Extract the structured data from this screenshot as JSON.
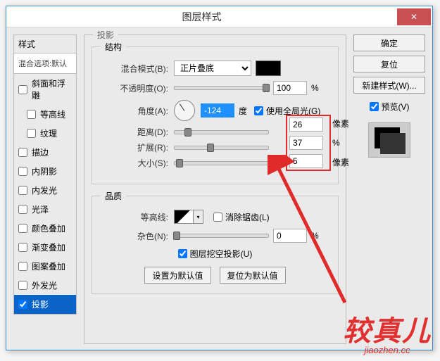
{
  "titlebar": {
    "title": "图层样式",
    "close": "✕"
  },
  "styles": {
    "header": "样式",
    "blend_options": "混合选项:默认",
    "items": [
      {
        "label": "斜面和浮雕",
        "checked": false
      },
      {
        "label": "等高线",
        "checked": false,
        "indent": true
      },
      {
        "label": "纹理",
        "checked": false,
        "indent": true
      },
      {
        "label": "描边",
        "checked": false
      },
      {
        "label": "内阴影",
        "checked": false
      },
      {
        "label": "内发光",
        "checked": false
      },
      {
        "label": "光泽",
        "checked": false
      },
      {
        "label": "颜色叠加",
        "checked": false
      },
      {
        "label": "渐变叠加",
        "checked": false
      },
      {
        "label": "图案叠加",
        "checked": false
      },
      {
        "label": "外发光",
        "checked": false
      },
      {
        "label": "投影",
        "checked": true
      }
    ]
  },
  "center": {
    "drop_shadow_title": "投影",
    "structure_title": "结构",
    "blend_mode_label": "混合模式(B):",
    "blend_mode_value": "正片叠底",
    "opacity_label": "不透明度(O):",
    "opacity_value": "100",
    "opacity_unit": "%",
    "angle_label": "角度(A):",
    "angle_value": "-124",
    "angle_unit": "度",
    "global_light_label": "使用全局光(G)",
    "distance_label": "距离(D):",
    "distance_value": "26",
    "distance_unit": "像素",
    "spread_label": "扩展(R):",
    "spread_value": "37",
    "spread_unit": "%",
    "size_label": "大小(S):",
    "size_value": "5",
    "size_unit": "像素",
    "quality_title": "品质",
    "contour_label": "等高线:",
    "antialias_label": "消除锯齿(L)",
    "noise_label": "杂色(N):",
    "noise_value": "0",
    "noise_unit": "%",
    "knockout_label": "图层挖空投影(U)",
    "make_default": "设置为默认值",
    "reset_default": "复位为默认值"
  },
  "right": {
    "ok": "确定",
    "cancel": "复位",
    "new_style": "新建样式(W)...",
    "preview": "预览(V)"
  },
  "watermark": {
    "big": "较真儿",
    "small": "jiaozhen.cc"
  }
}
